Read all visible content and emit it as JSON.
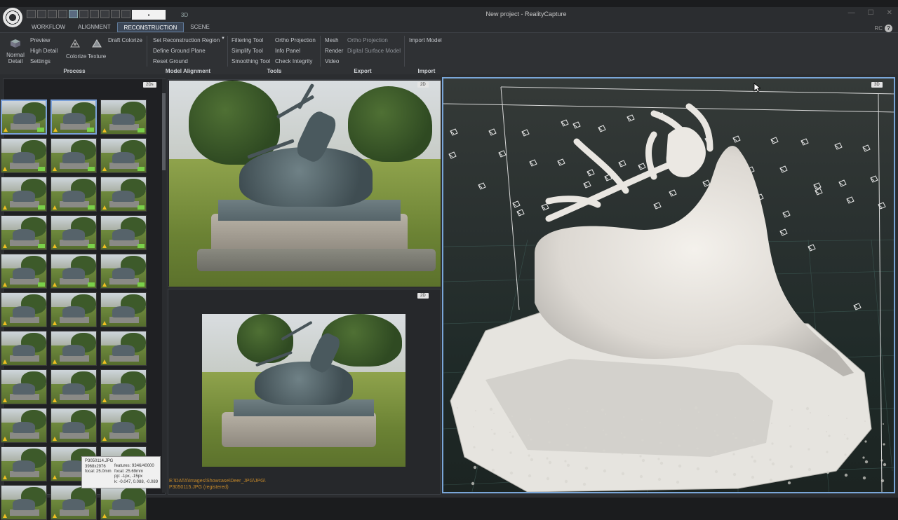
{
  "window": {
    "title": "New project - RealityCapture",
    "view_tab_3d": "3D",
    "user_initials": "RC",
    "help_label": "?"
  },
  "menu_tabs": [
    "WORKFLOW",
    "ALIGNMENT",
    "RECONSTRUCTION",
    "SCENE"
  ],
  "active_tab": "RECONSTRUCTION",
  "ribbon": {
    "process": {
      "label": "Process",
      "normal_detail": "Normal Detail",
      "preview": "Preview",
      "high_detail": "High Detail",
      "settings": "Settings",
      "colorize": "Colorize",
      "texture": "Texture",
      "draft_colorize": "Draft Colorize"
    },
    "model_alignment": {
      "label": "Model Alignment",
      "set_region": "Set Reconstruction Region",
      "define_ground": "Define Ground Plane",
      "reset_ground": "Reset Ground"
    },
    "tools": {
      "label": "Tools",
      "filtering": "Filtering Tool",
      "simplify": "Simplify Tool",
      "smoothing": "Smoothing Tool",
      "ortho_projection": "Ortho Projection",
      "info_panel": "Info Panel",
      "check_integrity": "Check Integrity"
    },
    "export": {
      "label": "Export",
      "mesh": "Mesh",
      "render": "Render",
      "video": "Video",
      "ortho_projection": "Ortho Projection",
      "dsm": "Digital Surface Model"
    },
    "import": {
      "label": "Import",
      "import_model": "Import Model"
    }
  },
  "panels": {
    "thumbs_badge": "2Ds",
    "photo1_badge": "2D",
    "photo2_badge": "2D",
    "view3d_badge": "3D"
  },
  "tooltip": {
    "filename": "P3050114.JPG",
    "resolution": "3968x2976",
    "focal": "focal: 25.0mm",
    "features": "features: 9346/40000",
    "focal2": "focal: 25.69mm",
    "pp": "pp: -1px, -15px",
    "k": "k: -0.047, 0.088, -0.089"
  },
  "status_path": {
    "line1": "E:\\DATA\\Images\\Showcase\\Deer_JPG\\JPG\\",
    "line2": "P3050115.JPG (registered)"
  }
}
